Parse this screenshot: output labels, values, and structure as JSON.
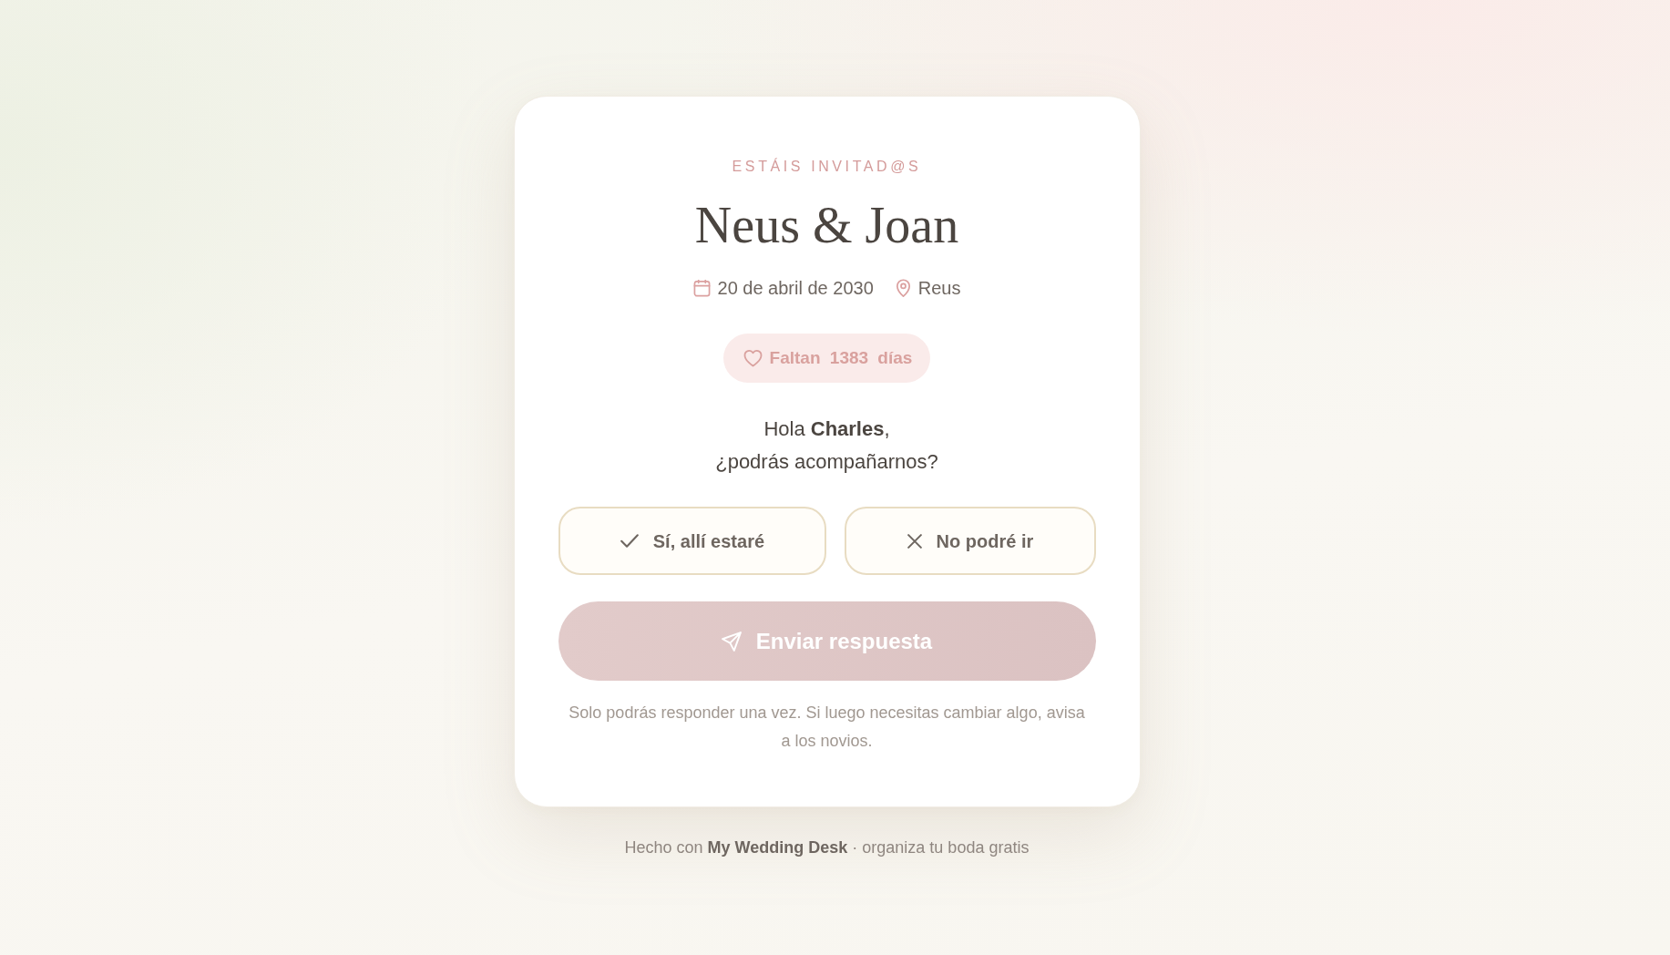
{
  "invitation": {
    "eyebrow": "ESTÁIS INVITAD@S",
    "couple": "Neus & Joan",
    "date": "20 de abril de 2030",
    "place": "Reus",
    "countdown": "Faltan 1383 días"
  },
  "greeting": [
    "Hola **Charles**,",
    "¿podrás acompañarnos?"
  ],
  "options": [
    {
      "kind": "yes",
      "label": "Sí, allí estaré",
      "selected": false
    },
    {
      "kind": "no",
      "label": "No podré ir",
      "selected": false
    }
  ],
  "send_button": {
    "label": "Enviar respuesta",
    "disabled": true
  },
  "note": "Solo podrás responder una vez. Si luego necesitas cambiar algo, avisa a los novios.",
  "footer": {
    "prefix": "Hecho con",
    "link": "My Wedding Desk",
    "suffix": "· organiza tu boda gratis"
  }
}
